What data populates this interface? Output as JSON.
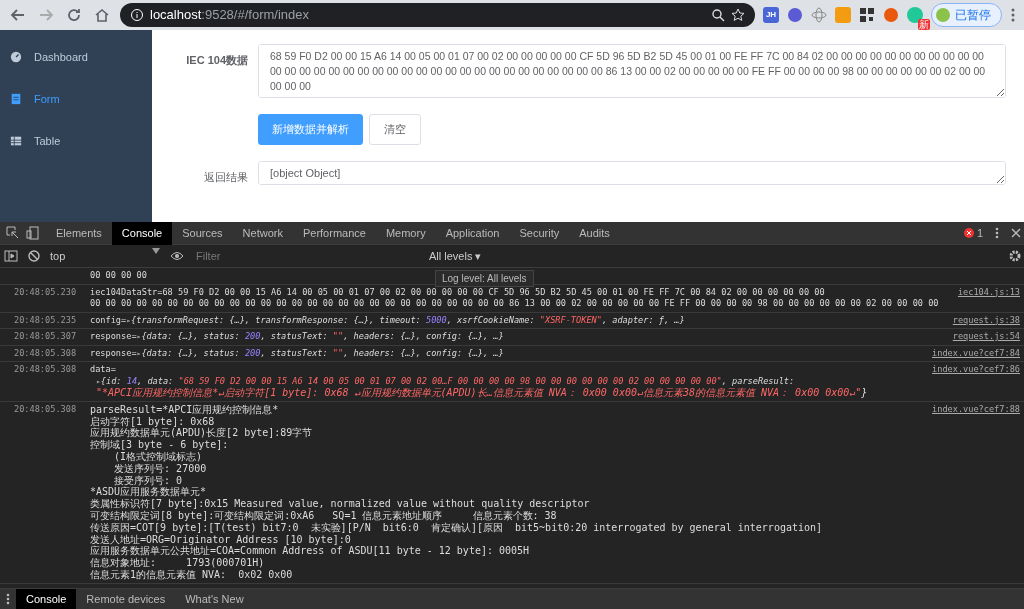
{
  "browser": {
    "url_host": "localhost",
    "url_rest": ":9528/#/form/index",
    "extension_text": "JH",
    "extension_badge": "新",
    "profile_label": "已暂停"
  },
  "sidebar": {
    "items": [
      {
        "label": "Dashboard",
        "kind": "gauge",
        "selected": false
      },
      {
        "label": "Form",
        "kind": "doc",
        "selected": true
      },
      {
        "label": "Table",
        "kind": "grid",
        "selected": false
      }
    ]
  },
  "form": {
    "data_label": "IEC 104数据",
    "data_value": "68 59 F0 D2 00 00 15 A6 14 00 05 00 01 07 00 02 00 00 00 00 00 CF 5D 96 5D B2 5D 45 00 01 00 FE FF 7C 00 84 02 00 00 00 00 00 00 00 00 00 00 00 00 00 00 00 00 00 00 00 00 00 00 00 00 00 00 00 00 00 00 00 00 00 00 86 13 00 00 02 00 00 00 00 00 FE FF 00 00 00 00 98 00 00 00 00 00 00 02 00 00 00 00 00",
    "primary_button": "新增数据并解析",
    "clear_button": "清空",
    "result_label": "返回结果",
    "result_value": "[object Object]"
  },
  "devtools": {
    "tabs": [
      {
        "label": "Elements",
        "selected": false
      },
      {
        "label": "Console",
        "selected": true
      },
      {
        "label": "Sources",
        "selected": false
      },
      {
        "label": "Network",
        "selected": false
      },
      {
        "label": "Performance",
        "selected": false
      },
      {
        "label": "Memory",
        "selected": false
      },
      {
        "label": "Application",
        "selected": false
      },
      {
        "label": "Security",
        "selected": false
      },
      {
        "label": "Audits",
        "selected": false
      }
    ],
    "error_count": "1",
    "context": "top",
    "filter_placeholder": "Filter",
    "levels": "All levels ▾",
    "tooltip": "Log level: All levels",
    "messages": [
      {
        "lines": [
          [
            {
              "kind": "plain",
              "text": "00 00 00 00"
            }
          ]
        ]
      },
      {
        "time": "20:48:05.230",
        "source": "iec104.js:13",
        "lines": [
          [
            {
              "kind": "plain",
              "text": "iec104DataStr=68 59 F0 D2 00 00 15 A6 14 00 05 00 01 07 00 02 00 00 00 00 00 CF 5D 96 5D B2 5D 45 00 01 00 FE FF 7C 00 84 02 00 00 00 00 00 00"
            }
          ],
          [
            {
              "kind": "plain",
              "text": "00 00 00 00 00 00 00 00 00 00 00 00 00 00 00 00 00 00 00 00 00 00 00 00 00 00 00 86 13 00 00 02 00 00 00 00 00 FE FF 00 00 00 00 98 00 00 00 00 00 00 02 00 00 00 00"
            }
          ]
        ]
      },
      {
        "time": "20:48:05.235",
        "source": "request.js:38",
        "lines": [
          [
            {
              "kind": "plain",
              "text": "config="
            },
            {
              "kind": "arrow",
              "text": "▸"
            },
            {
              "kind": "obj",
              "text": "{transformRequest: {…}, transformResponse: {…}, timeout: "
            },
            {
              "kind": "num",
              "text": "5000"
            },
            {
              "kind": "obj",
              "text": ", xsrfCookieName: "
            },
            {
              "kind": "str",
              "text": "\"XSRF-TOKEN\""
            },
            {
              "kind": "obj",
              "text": ", adapter: ƒ, …}"
            }
          ]
        ]
      },
      {
        "time": "20:48:05.307",
        "source": "request.js:54",
        "lines": [
          [
            {
              "kind": "plain",
              "text": "response="
            },
            {
              "kind": "arrow",
              "text": "▸"
            },
            {
              "kind": "obj",
              "text": "{data: {…}, status: "
            },
            {
              "kind": "num",
              "text": "200"
            },
            {
              "kind": "obj",
              "text": ", statusText: "
            },
            {
              "kind": "str",
              "text": "\"\""
            },
            {
              "kind": "obj",
              "text": ", headers: {…}, config: {…}, …}"
            }
          ]
        ]
      },
      {
        "time": "20:48:05.308",
        "source": "index.vue?cef7:84",
        "lines": [
          [
            {
              "kind": "plain",
              "text": "response="
            },
            {
              "kind": "arrow",
              "text": "▸"
            },
            {
              "kind": "obj",
              "text": "{data: {…}, status: "
            },
            {
              "kind": "num",
              "text": "200"
            },
            {
              "kind": "obj",
              "text": ", statusText: "
            },
            {
              "kind": "str",
              "text": "\"\""
            },
            {
              "kind": "obj",
              "text": ", headers: {…}, config: {…}, …}"
            }
          ]
        ]
      },
      {
        "time": "20:48:05.308",
        "source": "index.vue?cef7:86",
        "lines": [
          [
            {
              "kind": "plain",
              "text": "data="
            }
          ],
          [
            {
              "kind": "arrow",
              "text": "▸"
            },
            {
              "kind": "obj",
              "text": "{id: "
            },
            {
              "kind": "num",
              "text": "14"
            },
            {
              "kind": "obj",
              "text": ", data: "
            },
            {
              "kind": "str",
              "text": "\"68 59 F0 D2 00 00 15 A6 14 00 05 00 01 07 00 02 00…F 00 00 00 00 98 00 00 00 00 00 00 02 00 00 00 00 00\""
            },
            {
              "kind": "obj",
              "text": ", parseResult:"
            }
          ],
          [
            {
              "kind": "str",
              "text": " \"*APCI应用规约控制信息*↵启动字符[1 byte]: 0x68 ↵应用规约数据单元(APDU)长…信息元素值 NVA： 0x00 0x00↵信息元素38的信息元素值 NVA： 0x00 0x00↵\""
            },
            {
              "kind": "obj",
              "text": "}"
            }
          ]
        ]
      },
      {
        "time": "20:48:05.308",
        "source": "index.vue?cef7:88",
        "lines": [
          [
            {
              "kind": "plain",
              "text": "parseResult=*APCI应用规约控制信息*"
            }
          ],
          [
            {
              "kind": "plain",
              "text": "启动字符[1 byte]: 0x68"
            }
          ],
          [
            {
              "kind": "plain",
              "text": "应用规约数据单元(APDU)长度[2 byte]:89字节"
            }
          ],
          [
            {
              "kind": "plain",
              "text": "控制域[3 byte - 6 byte]:"
            }
          ],
          [
            {
              "kind": "plain",
              "text": "    (I格式控制域标志)"
            }
          ],
          [
            {
              "kind": "plain",
              "text": "    发送序列号: 27000"
            }
          ],
          [
            {
              "kind": "plain",
              "text": "    接受序列号: 0"
            }
          ],
          [
            {
              "kind": "plain",
              "text": "*ASDU应用服务数据单元*"
            }
          ],
          [
            {
              "kind": "plain",
              "text": "类属性标识符[7 byte]:0x15 Measured value, normalized value without quality descriptor"
            }
          ],
          [
            {
              "kind": "plain",
              "text": "可变结构限定词[8 byte]:可变结构限定词:0xA6   SQ=1 信息元素地址顺序     信息元素个数: 38"
            }
          ],
          [
            {
              "kind": "plain",
              "text": "传送原因=COT[9 byte]:[T(test) bit7:0  未实验][P/N  bit6:0  肯定确认][原因  bit5~bit0:20 interrogated by general interrogation]"
            }
          ],
          [
            {
              "kind": "plain",
              "text": "发送人地址=ORG=Originator Address [10 byte]:0"
            }
          ],
          [
            {
              "kind": "plain",
              "text": "应用服务数据单元公共地址=COA=Common Address of ASDU[11 byte - 12 byte]: 0005H"
            }
          ],
          [
            {
              "kind": "plain",
              "text": "信息对象地址:     1793(000701H)"
            }
          ],
          [
            {
              "kind": "plain",
              "text": "信息元素1的信息元素值 NVA:  0x02 0x00"
            }
          ]
        ]
      }
    ],
    "drawer_tabs": [
      {
        "label": "Console",
        "selected": true
      },
      {
        "label": "Remote devices",
        "selected": false
      },
      {
        "label": "What's New",
        "selected": false
      }
    ]
  }
}
